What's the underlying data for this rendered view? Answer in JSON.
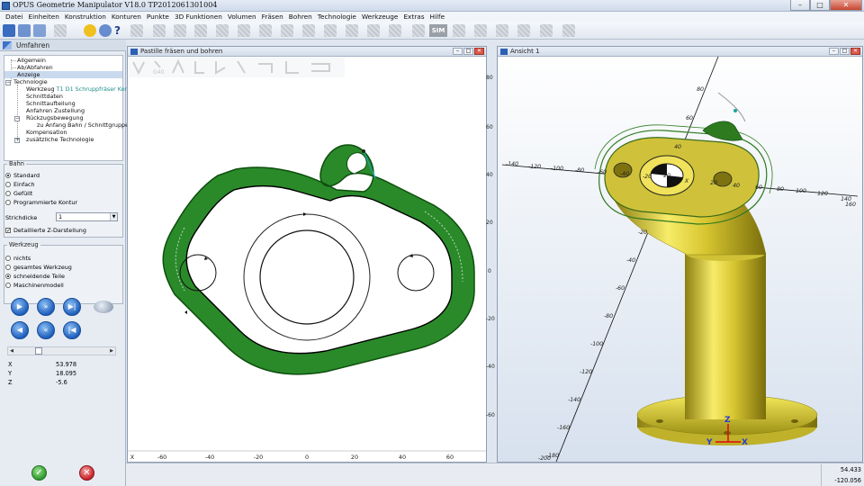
{
  "app": {
    "title": "OPUS Geometrie Manipulator V18.0   TP2012061301004",
    "window_controls": [
      "–",
      "□",
      "✕"
    ]
  },
  "menu": [
    "Datei",
    "Einheiten",
    "Konstruktion",
    "Konturen",
    "Punkte",
    "3D Funktionen",
    "Volumen",
    "Fräsen",
    "Bohren",
    "Technologie",
    "Werkzeuge",
    "Extras",
    "Hilfe"
  ],
  "toolbar": {
    "help": "?",
    "sim": "SIM"
  },
  "left_panel": {
    "header": "Umfahren",
    "tree": {
      "allgemein": "Allgemein",
      "ablaufen": "Ab/Abfahren",
      "anzeige": "Anzeige",
      "technologie": "Technologie",
      "werkzeug_prefix": "Werkzeug",
      "werkzeug_value": "T1 D1 Schruppfräser Kordel",
      "schnittdaten": "Schnittdaten",
      "schnittaufteilung": "Schnittaufteilung",
      "anfahren": "Anfahren Zustellung",
      "rueckzug": "Rückzugsbewegung",
      "zu_anfang": "zu Anfang Bahn / Schnittgruppe",
      "kompensation": "Kompensation",
      "zusaetzliche": "zusätzliche Technologie"
    },
    "bahn": {
      "legend": "Bahn",
      "options": [
        "Standard",
        "Einfach",
        "Gefüllt",
        "Programmierte Kontur"
      ],
      "selected": 0,
      "strichdicke_label": "Strichdicke",
      "strichdicke_value": "1",
      "detail_label": "Detaillierte Z-Darstellung",
      "detail_checked": true
    },
    "werkzeug": {
      "legend": "Werkzeug",
      "options": [
        "nichts",
        "gesamtes Werkzeug",
        "schneidende Teile",
        "Maschinenmodell"
      ],
      "selected": 2
    },
    "slider": 0.23,
    "coords": {
      "x_label": "X",
      "x": "53.978",
      "y_label": "Y",
      "y": "18.095",
      "z_label": "Z",
      "z": "-5.6"
    }
  },
  "view2d": {
    "title": "Pastille fräsen und bohren",
    "toolbar_label": "G40",
    "x_ticks": [
      "-60",
      "-40",
      "-20",
      "0",
      "20",
      "40",
      "60"
    ],
    "x_axis": "X",
    "y_ticks": [
      "80",
      "60",
      "40",
      "20",
      "0",
      "-20",
      "-40",
      "-60"
    ],
    "colors": {
      "path": "#1f7a1f",
      "path_edge": "#0c4d0c",
      "fill": "#2d8b2d"
    }
  },
  "view3d": {
    "title": "Ansicht 1",
    "x_ticks": [
      "-140",
      "-120",
      "-100",
      "-80",
      "-60",
      "-40",
      "-20",
      "X",
      "20",
      "40",
      "60",
      "80",
      "100",
      "120",
      "140",
      "160"
    ],
    "y_ticks": [
      "80",
      "60",
      "40",
      "20",
      "-20",
      "-40",
      "-60",
      "-80",
      "-100",
      "-120",
      "-140",
      "-160",
      "-180",
      "-200"
    ],
    "triad": {
      "z": "Z",
      "y": "Y",
      "x": "X"
    },
    "colors": {
      "solid": "#e3d43a",
      "solid_dark": "#a59a1a"
    }
  },
  "status": {
    "x": "54.433",
    "y": "-120.056"
  }
}
